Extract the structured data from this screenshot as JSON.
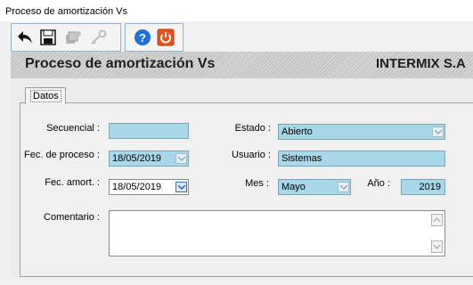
{
  "window": {
    "title": "Proceso de amortización Vs"
  },
  "toolbar": {
    "icons": [
      "back-arrow-icon",
      "save-icon",
      "process-icon",
      "key-icon",
      "help-icon",
      "power-icon"
    ]
  },
  "header": {
    "title": "Proceso de amortización Vs",
    "company": "INTERMIX S.A"
  },
  "tab": {
    "label": "Datos"
  },
  "form": {
    "secuencial": {
      "label": "Secuencial :",
      "value": ""
    },
    "fec_proceso": {
      "label": "Fec. de proceso :",
      "value": "18/05/2019"
    },
    "fec_amort": {
      "label": "Fec. amort. :",
      "value": "18/05/2019"
    },
    "comentario": {
      "label": "Comentario :",
      "value": ""
    },
    "estado": {
      "label": "Estado :",
      "value": "Abierto"
    },
    "usuario": {
      "label": "Usuario :",
      "value": "Sistemas"
    },
    "mes": {
      "label": "Mes :",
      "value": "Mayo"
    },
    "anio": {
      "label": "Año :",
      "value": "2019"
    }
  },
  "colors": {
    "field_bg": "#a8d8e8",
    "header_bg": "#c8c8c8",
    "toolbar_border": "#8fb6d6"
  }
}
